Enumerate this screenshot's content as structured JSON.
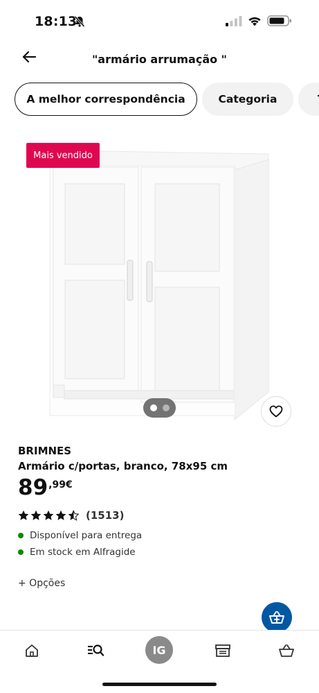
{
  "status_bar": {
    "time": "18:13",
    "icons": [
      "bell-slash-icon",
      "signal-icon",
      "wifi-icon",
      "battery-icon"
    ]
  },
  "header": {
    "title": "\"armário arrumação \"",
    "back_icon": "arrow-left-icon"
  },
  "filters": {
    "chips": [
      {
        "label": "A melhor correspondência",
        "selected": true
      },
      {
        "label": "Categoria",
        "selected": false
      },
      {
        "label": "T",
        "selected": false
      }
    ]
  },
  "product": {
    "badge": "Mais vendido",
    "badge_color": "#e00751",
    "carousel": {
      "count": 2,
      "active_index": 0
    },
    "brand": "BRIMNES",
    "description": "Armário c/portas, branco, 78x95 cm",
    "price_int": "89",
    "price_dec": ",99€",
    "rating_stars": 4.5,
    "rating_count": "(1513)",
    "availability": [
      {
        "text": "Disponível para entrega",
        "color": "#0a8a00"
      },
      {
        "text": "Em stock em Alfragide",
        "color": "#0a8a00"
      }
    ],
    "options": "+ Opções",
    "favorite_icon": "heart-icon"
  },
  "fab": {
    "icon": "add-to-cart-icon",
    "color": "#0058a3"
  },
  "bottom_nav": {
    "items": [
      {
        "icon": "home-icon"
      },
      {
        "icon": "search-list-icon"
      },
      {
        "icon": "profile-avatar",
        "label": "IG"
      },
      {
        "icon": "store-icon"
      },
      {
        "icon": "cart-icon"
      }
    ]
  }
}
